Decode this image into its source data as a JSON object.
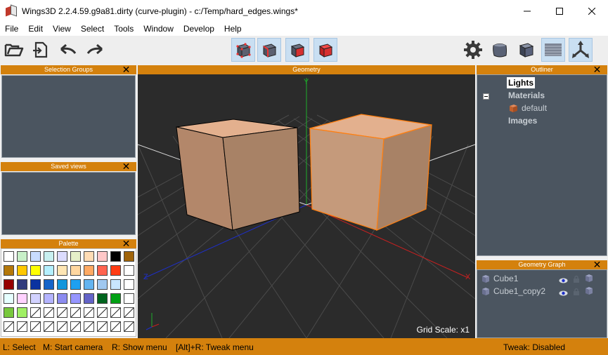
{
  "window": {
    "title": "Wings3D 2.2.4.59.g9a81.dirty (curve-plugin) - c:/Temp/hard_edges.wings*",
    "controls": [
      "minimize",
      "maximize",
      "close"
    ]
  },
  "menu": [
    "File",
    "Edit",
    "View",
    "Select",
    "Tools",
    "Window",
    "Develop",
    "Help"
  ],
  "toolbar": {
    "left_icons": [
      "open-folder-icon",
      "import-icon",
      "undo-icon",
      "redo-icon"
    ],
    "select_modes": [
      "vertex-mode-icon",
      "edge-mode-icon",
      "face-mode-icon",
      "body-mode-icon"
    ],
    "right_icons": [
      "gear-icon",
      "smooth-cube-icon",
      "flat-cube-icon",
      "ground-plane-icon",
      "axes-icon"
    ]
  },
  "panels": {
    "selection_groups": "Selection Groups",
    "saved_views": "Saved views",
    "palette": "Palette",
    "geometry": "Geometry",
    "outliner": "Outliner",
    "geometry_graph": "Geometry Graph"
  },
  "palette_colors": [
    [
      "#ffffff",
      "#c8f0c8",
      "#c8dcff",
      "#c8f0f0",
      "#dcdcff",
      "#e6f0c8",
      "#ffdcb4",
      "#ffc8c8",
      "#000000",
      "#a0640a"
    ],
    [
      "#b4780a",
      "#ffc800",
      "#ffff00",
      "#b4f0ff",
      "#ffe6b4",
      "#ffd7a0",
      "#ffaa64",
      "#ff6450",
      "#ff3c14",
      "#ffffff"
    ],
    [
      "#960000",
      "#323c7d",
      "#0a32a0",
      "#1464c8",
      "#1496dc",
      "#1ea0f0",
      "#64b4f0",
      "#a0c8f0",
      "#c8e6ff",
      "#ffffff"
    ],
    [
      "#e6ffff",
      "#ffd2ff",
      "#d2d2ff",
      "#b4b4ff",
      "#8c8cf0",
      "#9696ff",
      "#6464c8",
      "#00641e",
      "#00a014",
      "#ffffff"
    ],
    [
      "#78c83c",
      "#a0f064",
      "",
      "",
      "",
      "",
      "",
      "",
      "",
      ""
    ],
    [
      "",
      "",
      "",
      "",
      "",
      "",
      "",
      "",
      "",
      ""
    ]
  ],
  "viewport": {
    "grid_scale": "Grid Scale: x1"
  },
  "outliner": {
    "lights": "Lights",
    "materials": "Materials",
    "default_material": "default",
    "images": "Images"
  },
  "geometry_graph": {
    "objects": [
      "Cube1",
      "Cube1_copy2"
    ]
  },
  "status": {
    "select": "L: Select",
    "camera": "M: Start camera",
    "menu": "R: Show menu",
    "tweak_menu": "[Alt]+R: Tweak menu",
    "tweak_state": "Tweak: Disabled"
  },
  "colors": {
    "panel_bar": "#d4810d",
    "panel_body": "#4b5560",
    "viewport_bg": "#2b2b2b",
    "cube_face": "#c8997a",
    "selection_outline": "#ff7f10"
  }
}
